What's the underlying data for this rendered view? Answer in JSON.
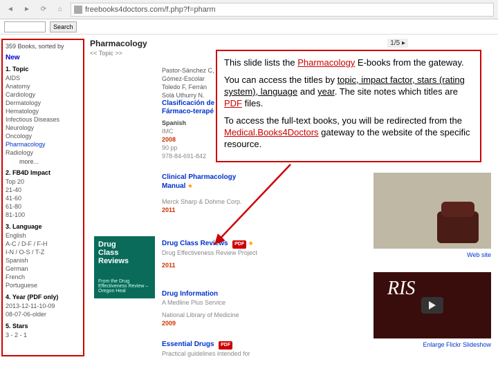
{
  "browser": {
    "url": "freebooks4doctors.com/f.php?f=pharm"
  },
  "subbar": {
    "search_placeholder": "",
    "search_btn": "Search"
  },
  "sidebar": {
    "title": "359 Books, sorted by",
    "new": "New",
    "sec_topic": "1. Topic",
    "topics": [
      "AIDS",
      "Anatomy",
      "Cardiology",
      "Dermatology",
      "Hematology",
      "Infectious Diseases",
      "Neurology",
      "Oncology",
      "Pharmacology",
      "Radiology"
    ],
    "more": "more...",
    "sec_impact": "2. FB4D Impact",
    "impacts": [
      "Top 20",
      "21-40",
      "41-60",
      "61-80",
      "81-100"
    ],
    "sec_lang": "3. Language",
    "langs_row1": "English",
    "langs_row2": "A-C / D-F / F-H",
    "langs_row3": "I-N / O-S / T-Z",
    "langs": [
      "Spanish",
      "German",
      "French",
      "Portuguese"
    ],
    "sec_year": "4. Year (PDF only)",
    "years": [
      "2013-12-11-10-09",
      "08-07-06-older"
    ],
    "sec_stars": "5. Stars",
    "stars": "3 - 2 - 1"
  },
  "main": {
    "heading": "Pharmacology",
    "sub": "<< Topic >>",
    "pager": "1/5 ▸",
    "entry1": {
      "author1": "Pastor-Sánchez C,",
      "author2": "Gómez-Escolar",
      "author3": "Toledo F, Ferrán",
      "author4": "Solà Uthurry N.",
      "title": "Clasificación de",
      "title2": "Fármaco-terapé",
      "lang": "Spanish",
      "pub": "IMC",
      "year": "2008",
      "pp": "90 pp",
      "isbn": "978-84-691-842"
    },
    "entry2": {
      "title": "Clinical Pharmacology",
      "title2": "Manual",
      "star": "★",
      "pub": "Merck Sharp & Dohme Corp.",
      "year": "2011"
    },
    "cover_drug": {
      "l1": "Drug",
      "l2": "Class",
      "l3": "Reviews",
      "sub": "From the Drug Effectiveness Review – Oregon Heal"
    },
    "entry3": {
      "title": "Drug Class Reviews",
      "pdf": "PDF",
      "star": "★",
      "pub": "Drug Effectiveness Review Project",
      "year": "2011"
    },
    "entry4": {
      "title": "Drug Information",
      "sub": "A Medline Plus Service",
      "pub": "National Library of Medicine",
      "year": "2009"
    },
    "entry5": {
      "title": "Essential Drugs",
      "pdf": "PDF",
      "sub": "Practical guidelines intended for"
    }
  },
  "right": {
    "photo_cap": "Web site",
    "video_txt": "RIS",
    "video_cap": "Enlarge Flickr Slideshow"
  },
  "callout": {
    "p1a": "This slide lists the ",
    "p1b": "Pharmacology",
    "p1c": " E-books from the gateway.",
    "p2a": "You can access the titles by ",
    "p2b": "topic, impact factor,  stars (rating system), language",
    "p2c": " and ",
    "p2d": "year",
    "p2e": ".  The site notes which titles are ",
    "p2f": "PDF",
    "p2g": " files.",
    "p3a": "To access the full-text books, you will be redirected from the ",
    "p3b": "Medical.Books4Doctors",
    "p3c": " gateway to the website of the specific resource."
  }
}
